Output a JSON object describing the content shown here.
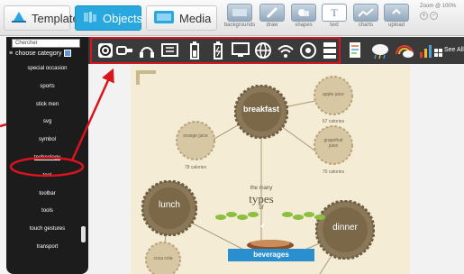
{
  "toolbar": {
    "tabs": [
      {
        "label": "Templates",
        "active": false
      },
      {
        "label": "Objects",
        "active": true
      },
      {
        "label": "Media",
        "active": false
      }
    ],
    "tools": [
      {
        "label": "backgrounds",
        "icon": "backgrounds-icon"
      },
      {
        "label": "draw",
        "icon": "pencil-icon"
      },
      {
        "label": "shapes",
        "icon": "shapes-icon"
      },
      {
        "label": "text",
        "icon": "text-icon"
      },
      {
        "label": "charts",
        "icon": "chart-icon"
      },
      {
        "label": "upload",
        "icon": "upload-icon"
      }
    ],
    "zoom": "Zoom @ 100%"
  },
  "sidebar": {
    "search_value": "Chercher",
    "choose_label": "choose category",
    "categories": [
      "special occasion",
      "sports",
      "stick men",
      "svg",
      "symbol",
      "technology",
      "tool",
      "toolbar",
      "tools",
      "touch gestures",
      "transport"
    ],
    "selected": "technology"
  },
  "icon_strip": {
    "icons": [
      "camera-icon",
      "usb-icon",
      "headphones-icon",
      "contact-card-icon",
      "battery-icon",
      "battery-charging-icon",
      "computer-monitor-icon",
      "globe-icon",
      "wifi-icon",
      "network-icon",
      "server-icon",
      "document-icon",
      "cloud-icon",
      "cloud-rainbow-icon",
      "wifi-signal-icon"
    ],
    "see_all": "See All"
  },
  "canvas": {
    "breakfast": "breakfast",
    "lunch": "lunch",
    "dinner": "dinner",
    "the_many": "the many",
    "types": "types",
    "of": "of",
    "beverages": "beverages",
    "apple_juice": "apple juice",
    "apple_cal": "67 calories",
    "orange_juice": "orange juice",
    "orange_cal": "78 calories",
    "grapefruit_juice": "grapefruit juice",
    "grapefruit_cal": "70 calories",
    "coca_cola": "coca cola"
  },
  "colors": {
    "accent": "#29a8e0",
    "annotation": "#d8141e",
    "panel": "#1c1c1c",
    "badge": "#8b7858"
  }
}
